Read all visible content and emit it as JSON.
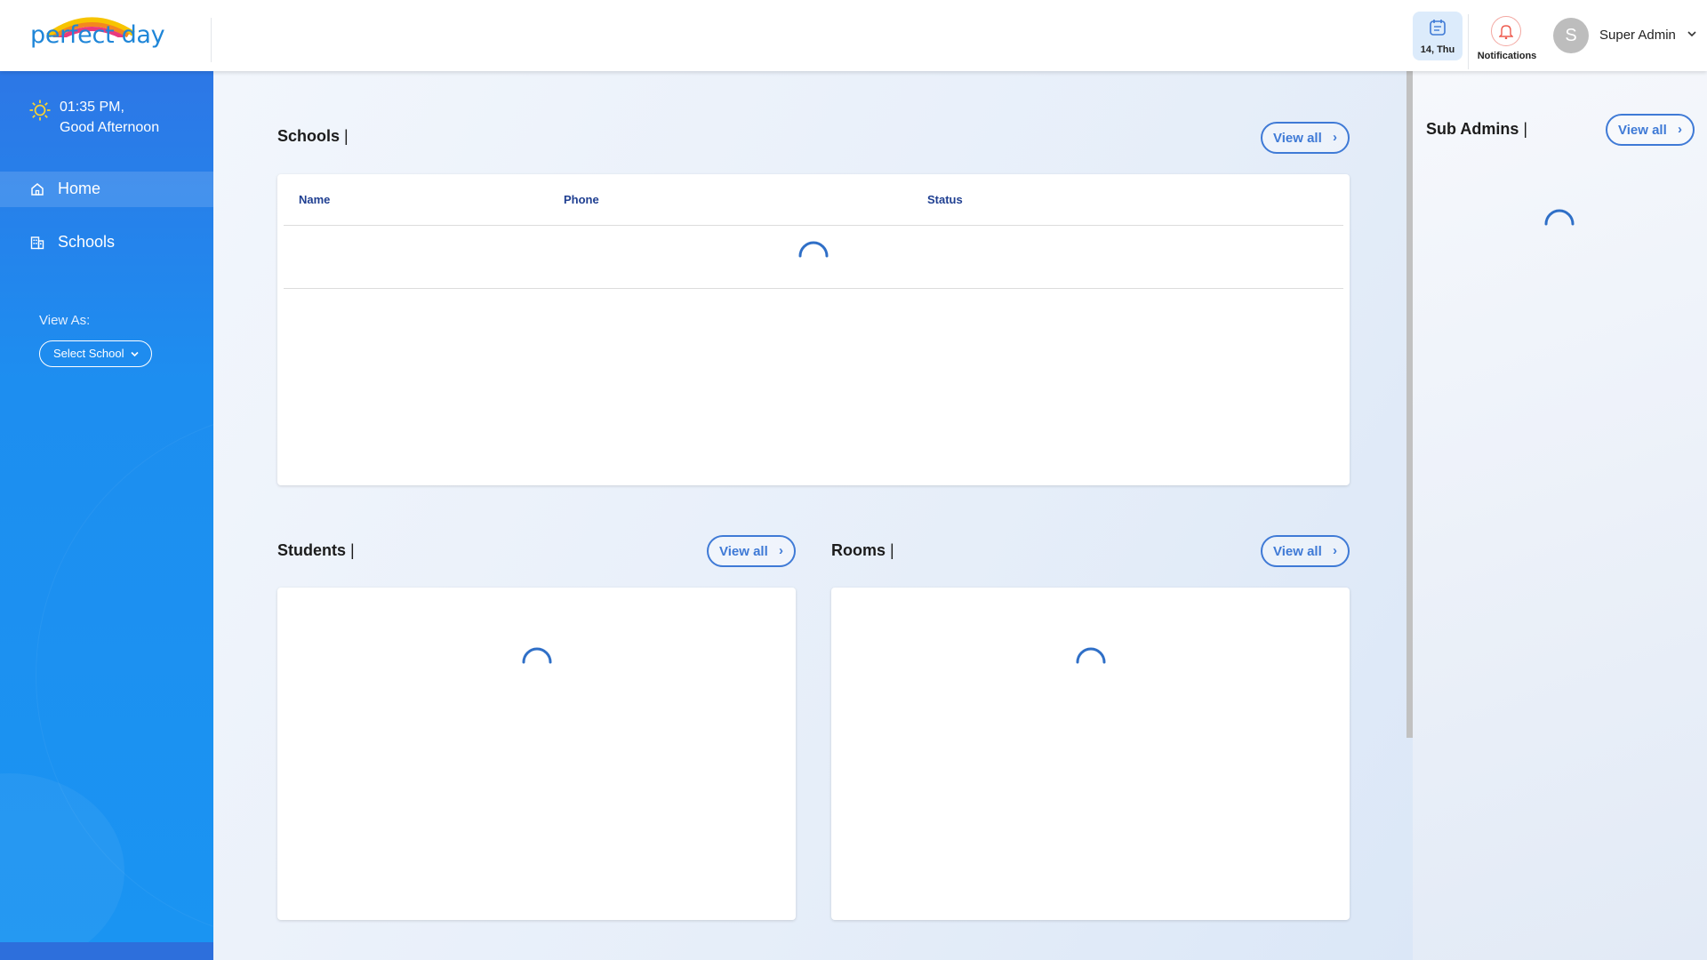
{
  "header": {
    "logo_text": "perfect day",
    "date_label": "14, Thu",
    "notifications_label": "Notifications",
    "avatar_initial": "S",
    "user_name": "Super Admin"
  },
  "sidebar": {
    "time": "01:35 PM,",
    "greeting": "Good Afternoon",
    "items": [
      {
        "label": "Home",
        "icon": "home-icon",
        "active": true
      },
      {
        "label": "Schools",
        "icon": "building-icon",
        "active": false
      }
    ],
    "view_as_label": "View As:",
    "select_school": "Select School"
  },
  "sections": {
    "schools": {
      "title": "Schools",
      "separator": "|",
      "view_all": "View all",
      "columns": [
        "Name",
        "Phone",
        "Status"
      ]
    },
    "students": {
      "title": "Students",
      "separator": "|",
      "view_all": "View all"
    },
    "rooms": {
      "title": "Rooms",
      "separator": "|",
      "view_all": "View all"
    },
    "sub_admins": {
      "title": "Sub Admins",
      "separator": "|",
      "view_all": "View all"
    }
  },
  "chevron": "›",
  "colors": {
    "primary": "#3f7ad6",
    "sidebar": "#1d8ef0",
    "table_header_text": "#1f3f91",
    "spinner": "#2f6fc7"
  }
}
